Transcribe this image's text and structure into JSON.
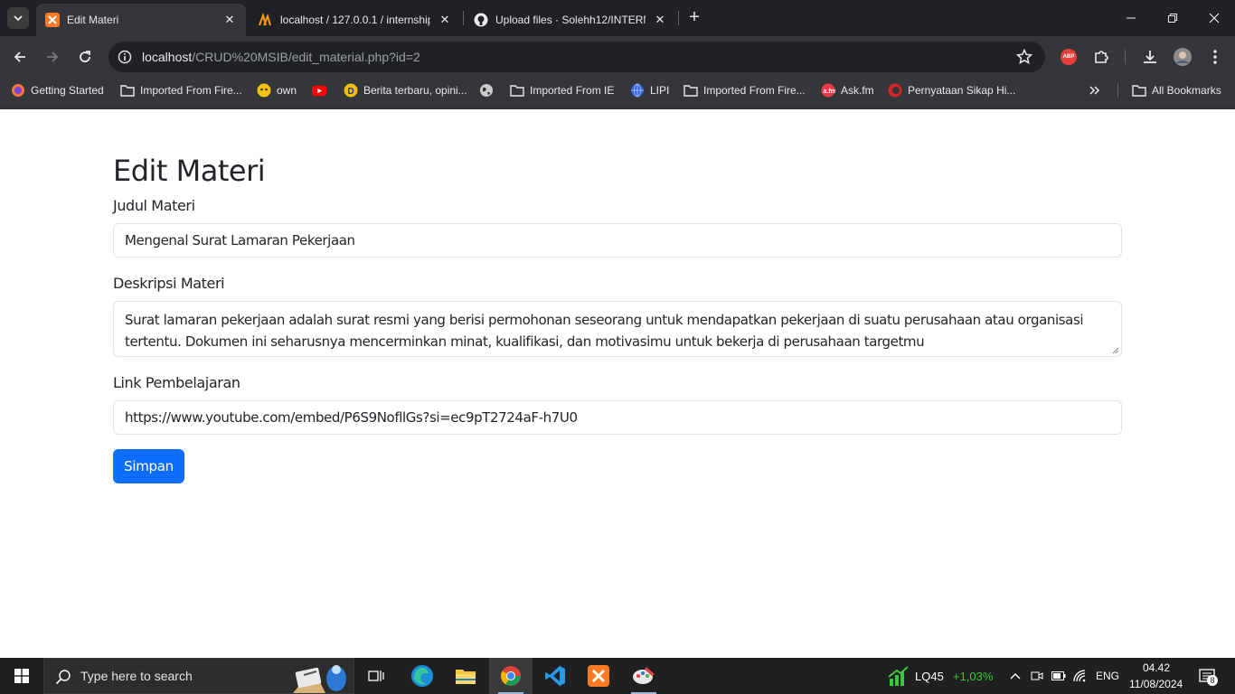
{
  "browser": {
    "tabs": [
      {
        "title": "Edit Materi",
        "active": true
      },
      {
        "title": "localhost / 127.0.0.1 / internship",
        "active": false
      },
      {
        "title": "Upload files · Solehh12/INTERN",
        "active": false
      }
    ],
    "url_host": "localhost",
    "url_path": "/CRUD%20MSIB/edit_material.php?id=2",
    "bookmarks": [
      "Getting Started",
      "Imported From Fire...",
      "own",
      "",
      "Berita terbaru, opini...",
      "",
      "Imported From IE",
      "LIPI",
      "Imported From Fire...",
      "Ask.fm",
      "Pernyataan Sikap Hi..."
    ],
    "all_bookmarks": "All Bookmarks",
    "abp_label": "ABP"
  },
  "page": {
    "title": "Edit Materi",
    "judul_label": "Judul Materi",
    "judul_value": "Mengenal Surat Lamaran Pekerjaan",
    "deskripsi_label": "Deskripsi Materi",
    "deskripsi_value": "Surat lamaran pekerjaan adalah surat resmi yang berisi permohonan seseorang untuk mendapatkan pekerjaan di suatu perusahaan atau organisasi tertentu. Dokumen ini seharusnya mencerminkan minat, kualifikasi, dan motivasimu untuk bekerja di perusahaan targetmu",
    "link_label": "Link Pembelajaran",
    "link_value": "https://www.youtube.com/embed/P6S9NofllGs?si=ec9pT2724aF-h7U0",
    "submit_label": "Simpan"
  },
  "taskbar": {
    "search_placeholder": "Type here to search",
    "stock_name": "LQ45",
    "stock_change": "+1,03%",
    "language": "ENG",
    "time": "04.42",
    "date": "11/08/2024",
    "notification_count": "8"
  },
  "colors": {
    "primary": "#0d6efd",
    "stock_up": "#3cc83c"
  }
}
